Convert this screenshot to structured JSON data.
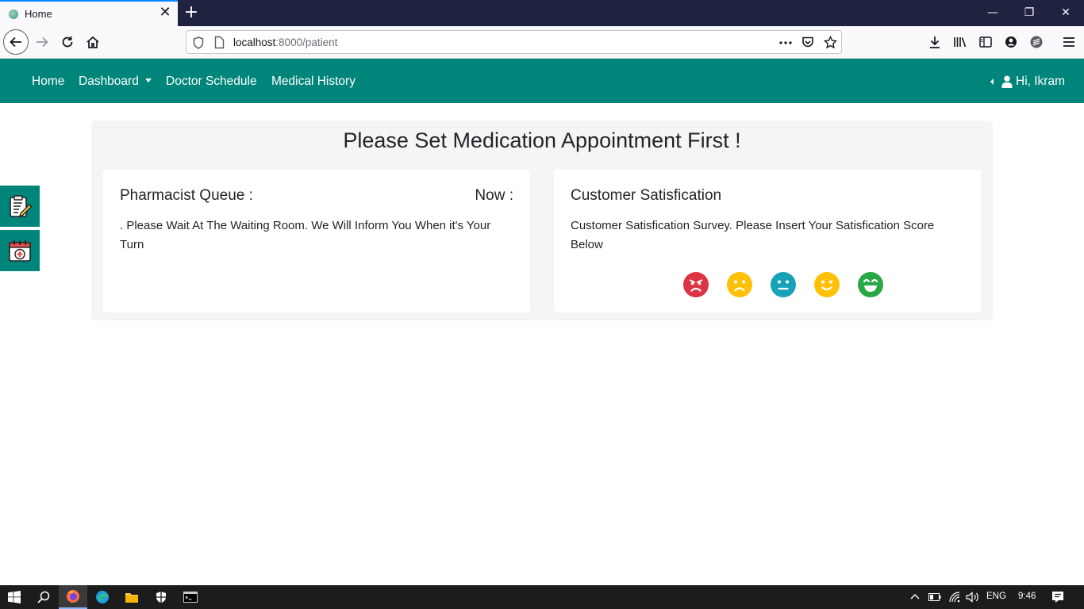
{
  "browser": {
    "tab_title": "Home",
    "tab_close": "✕",
    "new_tab": "+",
    "url_host": "localhost",
    "url_rest": ":8000/patient",
    "controls": {
      "minimize": "—",
      "restore": "❐",
      "close": "✕"
    }
  },
  "navbar": {
    "items": [
      {
        "label": "Home"
      },
      {
        "label": "Dashboard"
      },
      {
        "label": "Doctor Schedule"
      },
      {
        "label": "Medical History"
      }
    ],
    "user_greeting": "Hi, Ikram"
  },
  "main": {
    "title": "Please Set Medication Appointment First !",
    "queue_card": {
      "heading": "Pharmacist Queue :",
      "now_label": "Now :",
      "message": ". Please Wait At The Waiting Room. We Will Inform You When it's Your Turn"
    },
    "satisfaction_card": {
      "heading": "Customer Satisfication",
      "message": "Customer Satisfication Survey. Please Insert Your Satisfication Score Below",
      "faces": [
        {
          "icon": "angry-face-icon",
          "color": "#dc3545"
        },
        {
          "icon": "sad-face-icon",
          "color": "#ffc107"
        },
        {
          "icon": "neutral-face-icon",
          "color": "#17a2b8"
        },
        {
          "icon": "smile-face-icon",
          "color": "#ffc107"
        },
        {
          "icon": "grin-face-icon",
          "color": "#28a745"
        }
      ]
    }
  },
  "taskbar": {
    "language": "ENG",
    "time": "9:46"
  },
  "colors": {
    "brand": "#00857a",
    "panel_bg": "#f5f5f5"
  }
}
